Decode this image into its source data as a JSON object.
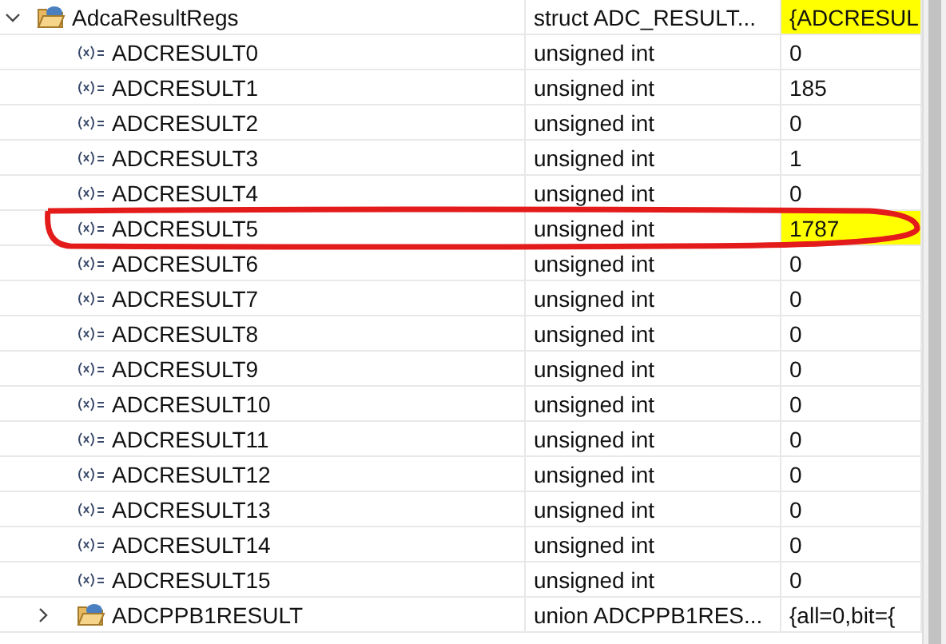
{
  "variables": [
    {
      "kind": "struct",
      "name": "AdcaResultRegs",
      "type": "struct ADC_RESULT...",
      "value": "{ADCRESUL",
      "changed": true,
      "expanded": true,
      "children": [
        {
          "kind": "field",
          "name": "ADCRESULT0",
          "type": "unsigned int",
          "value": "0",
          "changed": false
        },
        {
          "kind": "field",
          "name": "ADCRESULT1",
          "type": "unsigned int",
          "value": "185",
          "changed": false
        },
        {
          "kind": "field",
          "name": "ADCRESULT2",
          "type": "unsigned int",
          "value": "0",
          "changed": false
        },
        {
          "kind": "field",
          "name": "ADCRESULT3",
          "type": "unsigned int",
          "value": "1",
          "changed": false
        },
        {
          "kind": "field",
          "name": "ADCRESULT4",
          "type": "unsigned int",
          "value": "0",
          "changed": false
        },
        {
          "kind": "field",
          "name": "ADCRESULT5",
          "type": "unsigned int",
          "value": "1787",
          "changed": true
        },
        {
          "kind": "field",
          "name": "ADCRESULT6",
          "type": "unsigned int",
          "value": "0",
          "changed": false
        },
        {
          "kind": "field",
          "name": "ADCRESULT7",
          "type": "unsigned int",
          "value": "0",
          "changed": false
        },
        {
          "kind": "field",
          "name": "ADCRESULT8",
          "type": "unsigned int",
          "value": "0",
          "changed": false
        },
        {
          "kind": "field",
          "name": "ADCRESULT9",
          "type": "unsigned int",
          "value": "0",
          "changed": false
        },
        {
          "kind": "field",
          "name": "ADCRESULT10",
          "type": "unsigned int",
          "value": "0",
          "changed": false
        },
        {
          "kind": "field",
          "name": "ADCRESULT11",
          "type": "unsigned int",
          "value": "0",
          "changed": false
        },
        {
          "kind": "field",
          "name": "ADCRESULT12",
          "type": "unsigned int",
          "value": "0",
          "changed": false
        },
        {
          "kind": "field",
          "name": "ADCRESULT13",
          "type": "unsigned int",
          "value": "0",
          "changed": false
        },
        {
          "kind": "field",
          "name": "ADCRESULT14",
          "type": "unsigned int",
          "value": "0",
          "changed": false
        },
        {
          "kind": "field",
          "name": "ADCRESULT15",
          "type": "unsigned int",
          "value": "0",
          "changed": false
        },
        {
          "kind": "struct",
          "name": "ADCPPB1RESULT",
          "type": "union ADCPPB1RES...",
          "value": "{all=0,bit={",
          "changed": false,
          "expanded": false
        }
      ]
    }
  ]
}
